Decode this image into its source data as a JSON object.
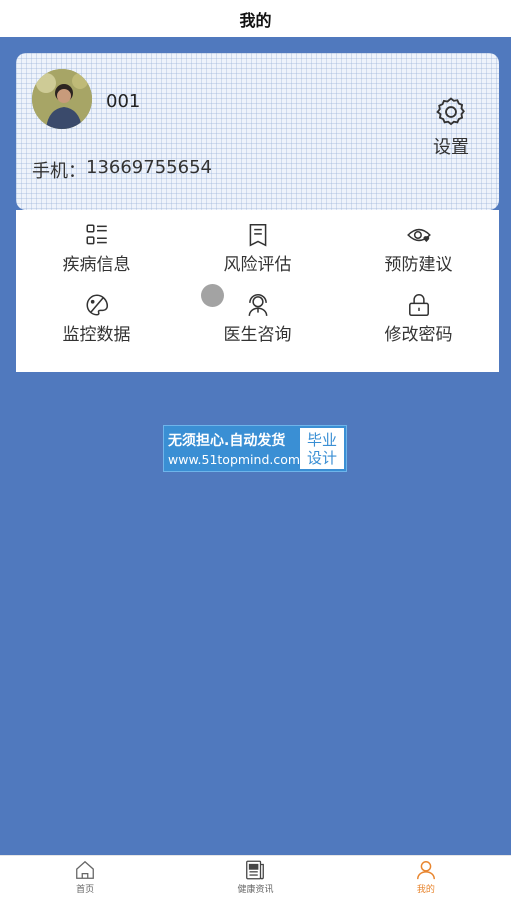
{
  "header": {
    "title": "我的"
  },
  "profile": {
    "username": "001",
    "phone_label": "手机：",
    "phone_value": "13669755654",
    "settings_label": "设置"
  },
  "menu": {
    "items": [
      {
        "label": "疾病信息",
        "icon": "list-grid-icon"
      },
      {
        "label": "风险评估",
        "icon": "document-icon"
      },
      {
        "label": "预防建议",
        "icon": "eye-heart-icon"
      },
      {
        "label": "监控数据",
        "icon": "palette-brush-icon"
      },
      {
        "label": "医生咨询",
        "icon": "doctor-icon"
      },
      {
        "label": "修改密码",
        "icon": "lock-icon"
      }
    ]
  },
  "watermark": {
    "line1": "无须担心.自动发货",
    "line2": "www.51topmind.com",
    "badge_line1": "毕业",
    "badge_line2": "设计"
  },
  "tabbar": {
    "tabs": [
      {
        "label": "首页",
        "icon": "home-icon",
        "active": false
      },
      {
        "label": "健康资讯",
        "icon": "news-icon",
        "active": false
      },
      {
        "label": "我的",
        "icon": "user-icon",
        "active": true
      }
    ]
  },
  "colors": {
    "background": "#5079be",
    "active_tab": "#e8852e",
    "watermark": "#3a8fd4"
  }
}
